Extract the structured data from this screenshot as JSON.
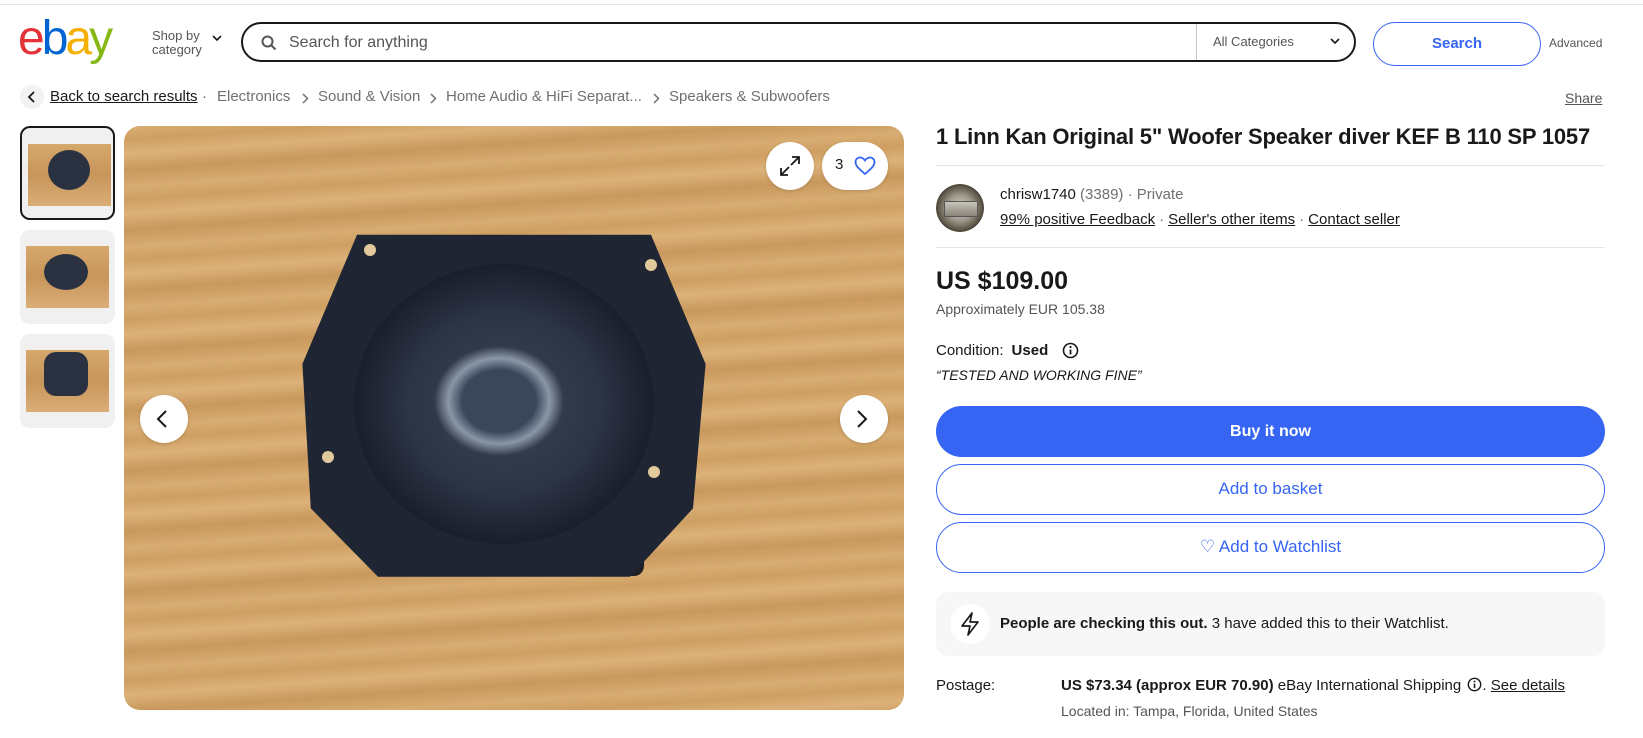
{
  "header": {
    "logo_letters": [
      "e",
      "b",
      "a",
      "y"
    ],
    "shop_by_line1": "Shop by",
    "shop_by_line2": "category",
    "search_placeholder": "Search for anything",
    "category_select": "All Categories",
    "search_button": "Search",
    "advanced_link": "Advanced"
  },
  "breadcrumb": {
    "back": "Back to search results",
    "items": [
      "Electronics",
      "Sound & Vision",
      "Home Audio & HiFi Separat...",
      "Speakers & Subwoofers"
    ],
    "separator_dot": "·"
  },
  "share_link": "Share",
  "gallery": {
    "watch_count": "3",
    "thumbnails": 3,
    "selected_index": 0
  },
  "listing": {
    "title": "1 Linn Kan Original 5\" Woofer Speaker diver KEF B 110 SP 1057",
    "seller": {
      "name": "chrisw1740",
      "feedback_count": "(3389)",
      "type": "· Private",
      "positive_feedback": "99% positive Feedback",
      "other_items": "Seller's other items",
      "contact": "Contact seller"
    },
    "price": "US $109.00",
    "approx_price": "Approximately EUR 105.38",
    "condition_label": "Condition:",
    "condition_value": "Used",
    "condition_quote": "“TESTED AND WORKING FINE”",
    "buy_now": "Buy it now",
    "add_to_basket": "Add to basket",
    "add_to_watchlist": "♡ Add to Watchlist",
    "people_bold": "People are checking this out.",
    "people_rest": " 3 have added this to their Watchlist.",
    "postage_label": "Postage:",
    "postage_amount": "US $73.34 (approx EUR 70.90)",
    "postage_service": " eBay International Shipping",
    "postage_dot": ". ",
    "see_details": "See details",
    "located_in": "Located in: Tampa, Florida, United States"
  },
  "colors": {
    "accent": "#3665f3",
    "text": "#191919",
    "muted": "#707070",
    "logo_e": "#e53238",
    "logo_b": "#0064d2",
    "logo_a": "#f5af02",
    "logo_y": "#86b817"
  },
  "icons": [
    "search-icon",
    "chevron-down-icon",
    "chevron-left-icon",
    "chevron-right-icon",
    "expand-icon",
    "heart-icon",
    "info-icon",
    "lightning-icon"
  ]
}
